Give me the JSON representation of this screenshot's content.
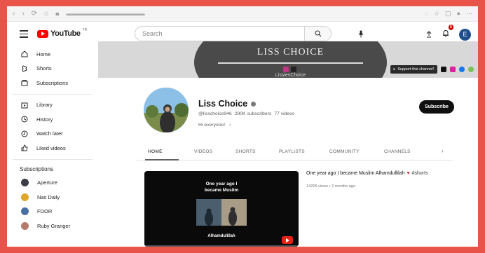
{
  "header": {
    "logo_text": "YouTube",
    "logo_tm": "TR",
    "search_placeholder": "Search",
    "notification_count": "9",
    "account_initial": "E"
  },
  "sidebar": {
    "main": [
      {
        "label": "Home",
        "icon": "home-icon"
      },
      {
        "label": "Shorts",
        "icon": "shorts-icon"
      },
      {
        "label": "Subscriptions",
        "icon": "subscriptions-icon"
      }
    ],
    "library": [
      {
        "label": "Library",
        "icon": "library-icon"
      },
      {
        "label": "History",
        "icon": "history-icon"
      },
      {
        "label": "Watch later",
        "icon": "watch-later-icon"
      },
      {
        "label": "Liked videos",
        "icon": "liked-videos-icon"
      }
    ],
    "subscriptions_heading": "Subscriptions",
    "subscriptions": [
      {
        "label": "Aperture",
        "color": "#3a3f47"
      },
      {
        "label": "Nas Daily",
        "color": "#e0a52a"
      },
      {
        "label": "FDOR",
        "color": "#4a6fa5"
      },
      {
        "label": "Ruby Granger",
        "color": "#b67a6a"
      }
    ]
  },
  "banner": {
    "title": "LISS CHOICE",
    "handle": "LissiesChoice",
    "support_label": "Support this channel!"
  },
  "channel": {
    "name": "Liss Choice",
    "handle": "@lisschoice946",
    "subscribers": "280K subscribers",
    "videos": "77 videos",
    "description": "Hi everyone!",
    "subscribe_label": "Subscribe"
  },
  "tabs": [
    "HOME",
    "VIDEOS",
    "SHORTS",
    "PLAYLISTS",
    "COMMUNITY",
    "CHANNELS"
  ],
  "featured": {
    "thumb_title_line1": "One year ago I",
    "thumb_title_line2": "became Muslim",
    "thumb_caption": "Alhamdulillah",
    "title": "One year ago I became Muslim  Alhamdullilah",
    "title_tag": "#shorts",
    "meta": "14206 views • 2 months ago"
  },
  "colors": {
    "accent_red": "#ff0000",
    "frame_border": "#e8544a"
  }
}
